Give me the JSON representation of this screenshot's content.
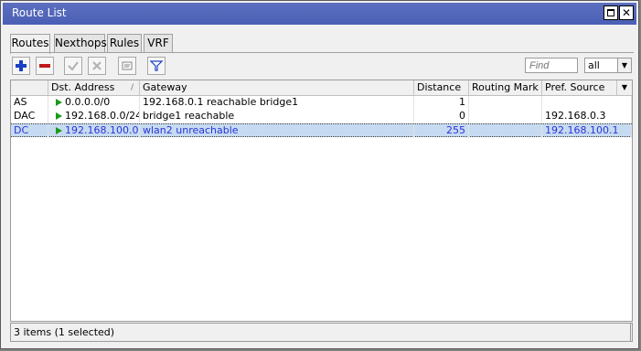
{
  "window": {
    "title": "Route List"
  },
  "tabs": [
    "Routes",
    "Nexthops",
    "Rules",
    "VRF"
  ],
  "toolbar": {
    "find_placeholder": "Find",
    "filter_value": "all",
    "buttons": [
      "add-icon",
      "remove-icon",
      "enable-icon",
      "disable-icon",
      "comment-icon",
      "filter-icon"
    ]
  },
  "table": {
    "columns": [
      "",
      "Dst. Address",
      "Gateway",
      "Distance",
      "Routing Mark",
      "Pref. Source"
    ],
    "sort_indicator": "/",
    "rows": [
      {
        "flags": "AS",
        "dst": "0.0.0.0/0",
        "gateway": "192.168.0.1 reachable bridge1",
        "distance": "1",
        "routing_mark": "",
        "pref_source": "",
        "selected": false
      },
      {
        "flags": "DAC",
        "dst": "192.168.0.0/24",
        "gateway": "bridge1 reachable",
        "distance": "0",
        "routing_mark": "",
        "pref_source": "192.168.0.3",
        "selected": false
      },
      {
        "flags": "DC",
        "dst": "192.168.100.0...",
        "gateway": "wlan2 unreachable",
        "distance": "255",
        "routing_mark": "",
        "pref_source": "192.168.100.1",
        "selected": true
      }
    ]
  },
  "status": {
    "text": "3 items (1 selected)"
  },
  "colors": {
    "titlebar": "#4a5fb5",
    "selection": "#c6dbf1",
    "selection_text": "#2b34d8",
    "route_flag": "#1a9a1a"
  }
}
